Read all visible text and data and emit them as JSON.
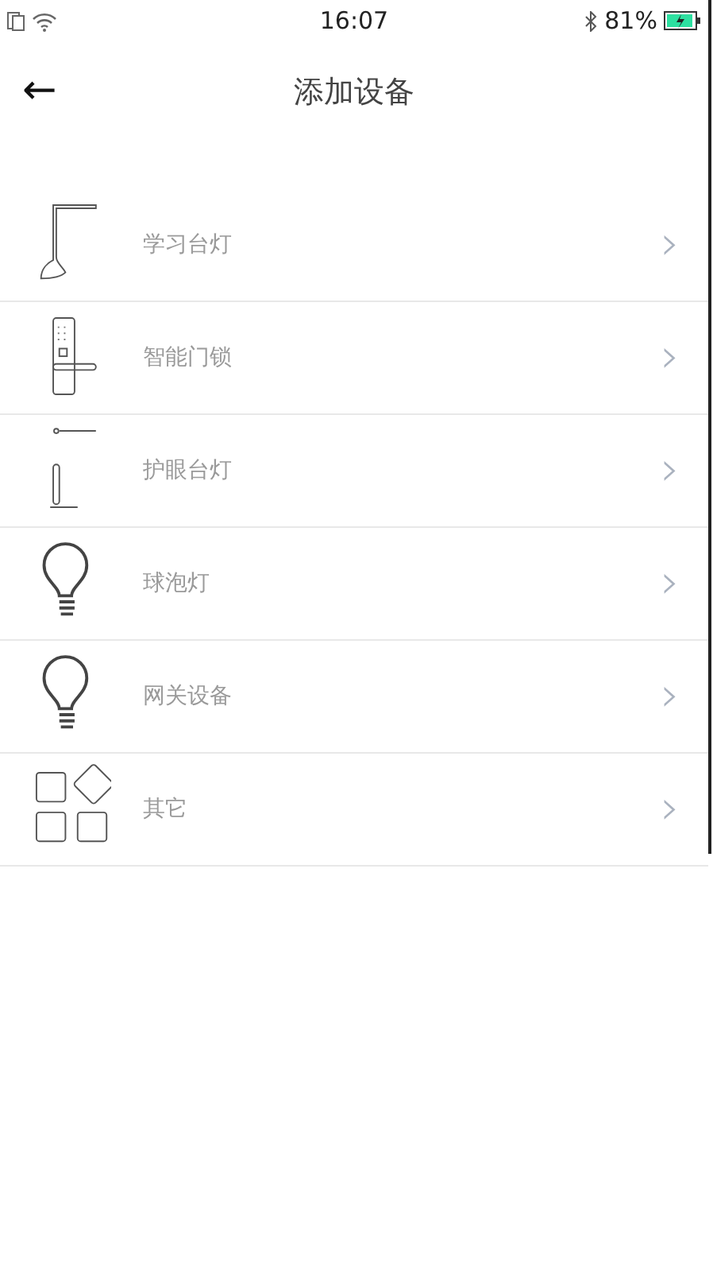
{
  "status_bar": {
    "time": "16:07",
    "battery": "81%"
  },
  "header": {
    "back": "←",
    "title": "添加设备"
  },
  "devices": [
    {
      "kind": "desk-lamp",
      "label": "学习台灯",
      "chevron": "›"
    },
    {
      "kind": "door-lock",
      "label": "智能门锁",
      "chevron": "›"
    },
    {
      "kind": "eye-lamp",
      "label": "护眼台灯",
      "chevron": "›"
    },
    {
      "kind": "bulb",
      "label": "球泡灯",
      "chevron": "›"
    },
    {
      "kind": "bulb",
      "label": "网关设备",
      "chevron": "›"
    },
    {
      "kind": "other",
      "label": "其它",
      "chevron": "›"
    }
  ]
}
